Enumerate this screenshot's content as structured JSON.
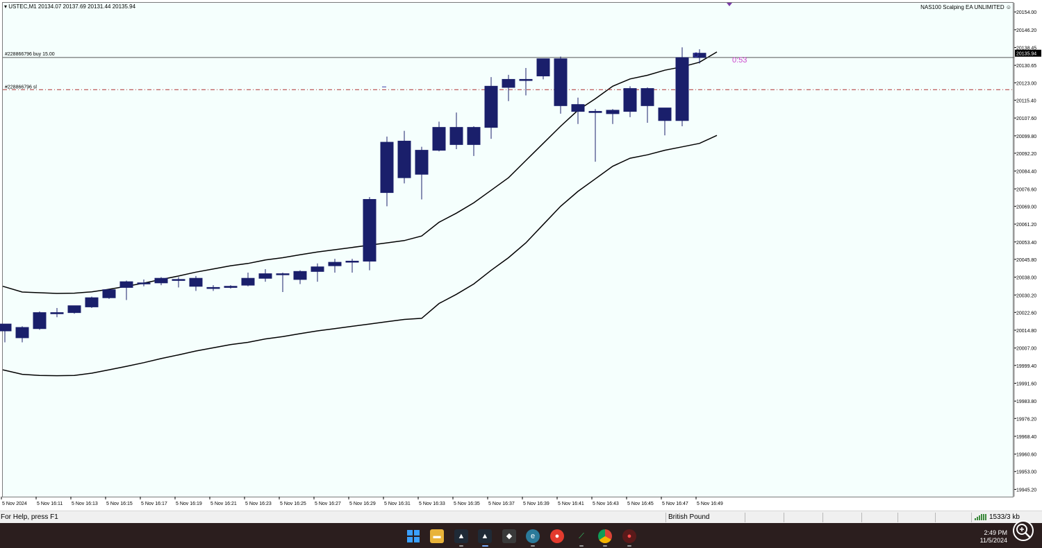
{
  "window": {
    "symbol_info": "USTEC,M1  20134.07 20137.69 20131.44 20135.94",
    "ea_name": "NAS100 Scalping EA UNLIMITED ☺"
  },
  "chart_data": {
    "type": "candlestick",
    "symbol": "USTEC",
    "timeframe": "M1",
    "ylim": [
      19942.0,
      20158.0
    ],
    "y_ticks": [
      "20154.00",
      "20146.20",
      "20138.45",
      "20130.65",
      "20123.00",
      "20115.40",
      "20107.60",
      "20099.80",
      "20092.20",
      "20084.40",
      "20076.60",
      "20069.00",
      "20061.20",
      "20053.40",
      "20045.80",
      "20038.00",
      "20030.20",
      "20022.60",
      "20014.80",
      "20007.00",
      "19999.40",
      "19991.60",
      "19983.80",
      "19976.20",
      "19968.40",
      "19960.60",
      "19953.00",
      "19945.20"
    ],
    "x_labels": [
      "5 Nov 2024",
      "5 Nov 16:11",
      "5 Nov 16:13",
      "5 Nov 16:15",
      "5 Nov 16:17",
      "5 Nov 16:19",
      "5 Nov 16:21",
      "5 Nov 16:23",
      "5 Nov 16:25",
      "5 Nov 16:27",
      "5 Nov 16:29",
      "5 Nov 16:31",
      "5 Nov 16:33",
      "5 Nov 16:35",
      "5 Nov 16:37",
      "5 Nov 16:39",
      "5 Nov 16:41",
      "5 Nov 16:43",
      "5 Nov 16:45",
      "5 Nov 16:47",
      "5 Nov 16:49"
    ],
    "candles": [
      {
        "o": 20014.5,
        "h": 20016.5,
        "l": 20009.5,
        "c": 20017.5
      },
      {
        "o": 20011.5,
        "h": 20016.5,
        "l": 20009.5,
        "c": 20016.0
      },
      {
        "o": 20015.5,
        "h": 20023.0,
        "l": 20015.0,
        "c": 20022.5
      },
      {
        "o": 20022.0,
        "h": 20024.5,
        "l": 20020.5,
        "c": 20022.5
      },
      {
        "o": 20022.5,
        "h": 20025.5,
        "l": 20022.0,
        "c": 20025.5
      },
      {
        "o": 20025.0,
        "h": 20029.5,
        "l": 20024.5,
        "c": 20029.0
      },
      {
        "o": 20029.0,
        "h": 20033.0,
        "l": 20028.5,
        "c": 20032.5
      },
      {
        "o": 20033.5,
        "h": 20036.5,
        "l": 20028.0,
        "c": 20036.0
      },
      {
        "o": 20035.5,
        "h": 20037.0,
        "l": 20034.0,
        "c": 20035.5
      },
      {
        "o": 20035.5,
        "h": 20038.0,
        "l": 20034.5,
        "c": 20037.5
      },
      {
        "o": 20037.0,
        "h": 20038.0,
        "l": 20033.5,
        "c": 20037.0
      },
      {
        "o": 20037.5,
        "h": 20038.5,
        "l": 20032.0,
        "c": 20034.0
      },
      {
        "o": 20033.5,
        "h": 20034.5,
        "l": 20032.0,
        "c": 20033.5
      },
      {
        "o": 20033.5,
        "h": 20034.5,
        "l": 20033.0,
        "c": 20034.0
      },
      {
        "o": 20034.5,
        "h": 20040.0,
        "l": 20034.0,
        "c": 20037.5
      },
      {
        "o": 20037.5,
        "h": 20041.5,
        "l": 20036.0,
        "c": 20039.5
      },
      {
        "o": 20039.5,
        "h": 20040.0,
        "l": 20031.5,
        "c": 20039.5
      },
      {
        "o": 20037.0,
        "h": 20041.0,
        "l": 20035.0,
        "c": 20040.5
      },
      {
        "o": 20040.5,
        "h": 20044.0,
        "l": 20036.0,
        "c": 20042.5
      },
      {
        "o": 20043.0,
        "h": 20046.0,
        "l": 20040.0,
        "c": 20044.5
      },
      {
        "o": 20045.0,
        "h": 20046.0,
        "l": 20040.0,
        "c": 20045.0
      },
      {
        "o": 20045.0,
        "h": 20073.0,
        "l": 20041.0,
        "c": 20072.0
      },
      {
        "o": 20075.0,
        "h": 20099.5,
        "l": 20069.0,
        "c": 20097.0
      },
      {
        "o": 20081.5,
        "h": 20102.0,
        "l": 20079.0,
        "c": 20097.5
      },
      {
        "o": 20083.0,
        "h": 20095.0,
        "l": 20072.0,
        "c": 20093.5
      },
      {
        "o": 20093.5,
        "h": 20106.0,
        "l": 20093.0,
        "c": 20103.5
      },
      {
        "o": 20096.0,
        "h": 20110.0,
        "l": 20094.0,
        "c": 20103.5
      },
      {
        "o": 20096.0,
        "h": 20104.0,
        "l": 20091.0,
        "c": 20103.5
      },
      {
        "o": 20103.5,
        "h": 20125.5,
        "l": 20098.5,
        "c": 20121.5
      },
      {
        "o": 20121.0,
        "h": 20126.5,
        "l": 20115.0,
        "c": 20124.5
      },
      {
        "o": 20124.0,
        "h": 20129.5,
        "l": 20117.5,
        "c": 20124.5
      },
      {
        "o": 20126.0,
        "h": 20133.5,
        "l": 20124.5,
        "c": 20133.5
      },
      {
        "o": 20133.5,
        "h": 20134.5,
        "l": 20109.5,
        "c": 20113.0
      },
      {
        "o": 20113.5,
        "h": 20116.5,
        "l": 20105.0,
        "c": 20110.5
      },
      {
        "o": 20110.5,
        "h": 20111.5,
        "l": 20088.5,
        "c": 20110.0
      },
      {
        "o": 20109.5,
        "h": 20111.5,
        "l": 20105.0,
        "c": 20111.0
      },
      {
        "o": 20110.5,
        "h": 20121.5,
        "l": 20108.0,
        "c": 20120.5
      },
      {
        "o": 20120.5,
        "h": 20121.0,
        "l": 20105.5,
        "c": 20113.0
      },
      {
        "o": 20106.5,
        "h": 20112.0,
        "l": 20100.0,
        "c": 20112.0
      },
      {
        "o": 20106.5,
        "h": 20138.5,
        "l": 20104.0,
        "c": 20134.0
      },
      {
        "o": 20134.07,
        "h": 20137.69,
        "l": 20131.44,
        "c": 20135.94
      }
    ],
    "envelope_upper": [
      20034.0,
      20031.5,
      20031.2,
      20030.9,
      20031.0,
      20031.6,
      20032.7,
      20034.0,
      20035.4,
      20037.0,
      20038.5,
      20040.2,
      20041.6,
      20043.0,
      20044.0,
      20045.5,
      20046.5,
      20047.8,
      20049.0,
      20050.0,
      20051.0,
      20052.0,
      20053.0,
      20054.0,
      20056.0,
      20062.0,
      20066.0,
      20070.5,
      20076.0,
      20081.5,
      20089.0,
      20096.5,
      20104.0,
      20111.0,
      20116.0,
      20121.5,
      20124.7,
      20126.3,
      20128.5,
      20130.0,
      20132.0,
      20136.5
    ],
    "envelope_lower": [
      19997.5,
      19995.5,
      19995.0,
      19994.9,
      19995.0,
      19996.0,
      19997.5,
      19999.0,
      20000.6,
      20002.4,
      20004.0,
      20005.7,
      20007.1,
      20008.5,
      20009.5,
      20011.0,
      20012.0,
      20013.3,
      20014.5,
      20015.5,
      20016.5,
      20017.5,
      20018.5,
      20019.5,
      20020.0,
      20026.5,
      20030.5,
      20035.0,
      20041.0,
      20046.5,
      20053.0,
      20061.0,
      20069.0,
      20075.5,
      20081.0,
      20086.5,
      20090.0,
      20091.5,
      20093.5,
      20095.0,
      20096.5,
      20100.0
    ],
    "current_price": "20135.94",
    "buy_order": {
      "label": "#228866796 buy 15.00",
      "price": 20134.07
    },
    "stop_loss": {
      "label": "#228866796 sl",
      "price": 20120.0
    },
    "countdown": "0:53",
    "colors": {
      "candle": "#1a1f6b",
      "envelope": "#000000",
      "order_line": "#555555",
      "sl_line": "#b03030",
      "countdown": "#cc44cc",
      "price_tag_bg": "#000000"
    }
  },
  "statusbar": {
    "help_text": "For Help, press F1",
    "profile": "British Pound",
    "traffic": "1533/3 kb"
  },
  "taskbar": {
    "time": "2:49 PM",
    "date": "11/5/2024",
    "icons": [
      "windows-start-icon",
      "file-explorer-icon",
      "metatrader-icon",
      "metatrader-icon",
      "cat-app-icon",
      "edge-icon",
      "red-app-icon",
      "green-chart-icon",
      "chrome-icon",
      "recorder-icon"
    ]
  }
}
